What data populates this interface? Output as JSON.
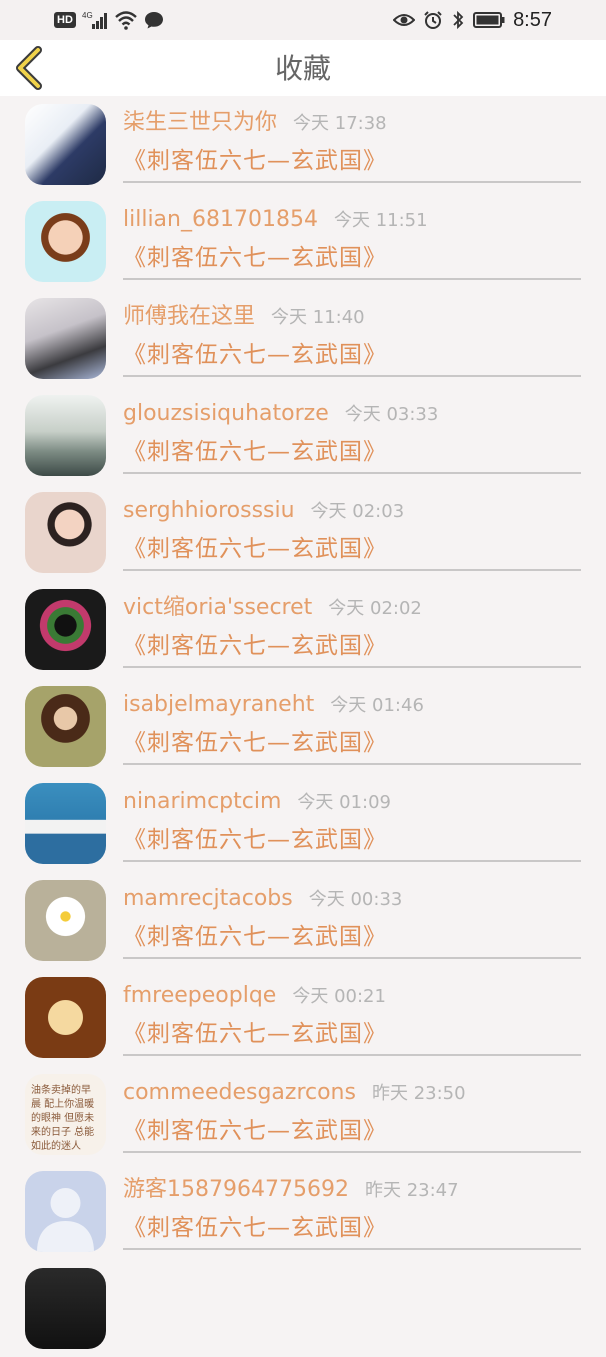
{
  "status_bar": {
    "left_badge": "HD",
    "signal": "4G",
    "time": "8:57",
    "icons": [
      "hd-icon",
      "signal-icon",
      "wifi-icon",
      "chat-icon",
      "eye-icon",
      "alarm-icon",
      "bluetooth-icon",
      "battery-icon"
    ]
  },
  "header": {
    "title": "收藏",
    "back_icon": "chevron-left-icon"
  },
  "colors": {
    "name_color": "#e59e6a",
    "work_color": "#e0915a",
    "time_color": "#b5b5b5",
    "divider": "#c9c7c7",
    "back_icon_fill": "#f0d24a"
  },
  "items": [
    {
      "name": "柒生三世只为你",
      "time": "今天 17:38",
      "work": "《刺客伍六七—玄武国》"
    },
    {
      "name": "lillian_681701854",
      "time": "今天 11:51",
      "work": "《刺客伍六七—玄武国》"
    },
    {
      "name": "师傅我在这里",
      "time": "今天 11:40",
      "work": "《刺客伍六七—玄武国》"
    },
    {
      "name": "glouzsisiquhatorze",
      "time": "今天 03:33",
      "work": "《刺客伍六七—玄武国》"
    },
    {
      "name": "serghhiorosssiu",
      "time": "今天 02:03",
      "work": "《刺客伍六七—玄武国》"
    },
    {
      "name": "vict缩oria'ssecret",
      "time": "今天 02:02",
      "work": "《刺客伍六七—玄武国》"
    },
    {
      "name": "isabjelmayraneht",
      "time": "今天 01:46",
      "work": "《刺客伍六七—玄武国》"
    },
    {
      "name": "ninarimcptcim",
      "time": "今天 01:09",
      "work": "《刺客伍六七—玄武国》"
    },
    {
      "name": "mamrecjtacobs",
      "time": "今天 00:33",
      "work": "《刺客伍六七—玄武国》"
    },
    {
      "name": "fmreepeoplqe",
      "time": "今天 00:21",
      "work": "《刺客伍六七—玄武国》"
    },
    {
      "name": "commeedesgazrcons",
      "time": "昨天 23:50",
      "work": "《刺客伍六七—玄武国》"
    },
    {
      "name": "游客1587964775692",
      "time": "昨天 23:47",
      "work": "《刺客伍六七—玄武国》"
    },
    {
      "name": "",
      "time": "",
      "work": ""
    }
  ],
  "avatar_text_11": "油条卖掉的早晨 配上你温暖的眼神 但愿未来的日子 总能如此的迷人"
}
